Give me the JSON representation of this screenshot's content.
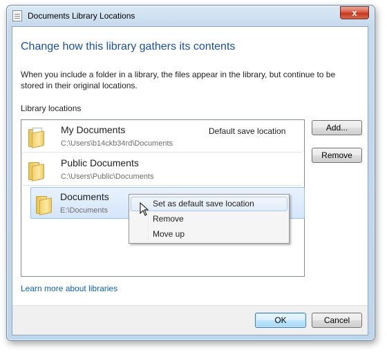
{
  "window": {
    "title": "Documents Library Locations",
    "close_glyph": "x"
  },
  "content": {
    "heading": "Change how this library gathers its contents",
    "description": "When you include a folder in a library, the files appear in the library, but continue to be stored in their original locations.",
    "section_label": "Library locations",
    "learn_more_link": "Learn more about libraries"
  },
  "locations": [
    {
      "name": "My Documents",
      "path": "C:\\Users\\b14ckb34rd\\Documents",
      "default_label": "Default save location",
      "icon": "documents-folder-icon"
    },
    {
      "name": "Public Documents",
      "path": "C:\\Users\\Public\\Documents",
      "icon": "folder-icon"
    },
    {
      "name": "Documents",
      "path": "E:\\Documents",
      "icon": "folder-icon",
      "selected": true
    }
  ],
  "side_buttons": {
    "add_label": "Add...",
    "remove_label": "Remove"
  },
  "context_menu": {
    "items": [
      "Set as default save location",
      "Remove",
      "Move up"
    ],
    "hovered_index": 0
  },
  "footer": {
    "ok_label": "OK",
    "cancel_label": "Cancel"
  },
  "colors": {
    "heading": "#1b4fa0",
    "link": "#0b5fbd",
    "selection": "#d4e6fb"
  }
}
